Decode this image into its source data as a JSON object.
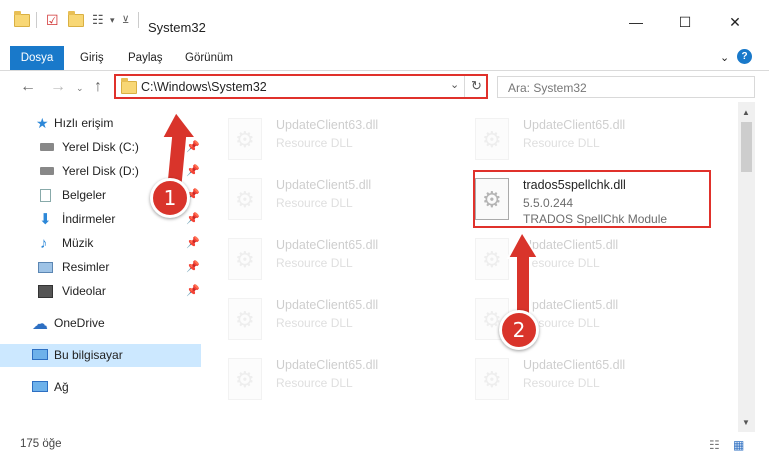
{
  "window": {
    "title": "System32",
    "minimize": "—",
    "maximize": "☐",
    "close": "✕"
  },
  "ribbon": {
    "tabs": [
      "Dosya",
      "Giriş",
      "Paylaş",
      "Görünüm"
    ]
  },
  "nav": {
    "back": "←",
    "forward": "→",
    "up": "↑",
    "address": "C:\\Windows\\System32",
    "search_placeholder": "Ara: System32"
  },
  "sidebar": {
    "items": [
      {
        "label": "Hızlı erişim",
        "icon": "star-icon"
      },
      {
        "label": "Yerel Disk (C:)",
        "icon": "drive-icon"
      },
      {
        "label": "Yerel Disk (D:)",
        "icon": "drive-icon"
      },
      {
        "label": "Belgeler",
        "icon": "documents-icon"
      },
      {
        "label": "İndirmeler",
        "icon": "download-icon"
      },
      {
        "label": "Müzik",
        "icon": "music-icon"
      },
      {
        "label": "Resimler",
        "icon": "pictures-icon"
      },
      {
        "label": "Videolar",
        "icon": "video-icon"
      },
      {
        "label": "OneDrive",
        "icon": "cloud-icon"
      },
      {
        "label": "Bu bilgisayar",
        "icon": "computer-icon"
      },
      {
        "label": "Ağ",
        "icon": "network-icon"
      }
    ]
  },
  "files": {
    "left": [
      {
        "name": "UpdateClient63.dll",
        "desc": "Resource DLL"
      },
      {
        "name": "UpdateClient5.dll",
        "desc": "Resource DLL"
      },
      {
        "name": "UpdateClient65.dll",
        "desc": "Resource DLL"
      },
      {
        "name": "UpdateClient65.dll",
        "desc": "Resource DLL"
      },
      {
        "name": "UpdateClient65.dll",
        "desc": "Resource DLL"
      }
    ],
    "right": [
      {
        "name": "UpdateClient65.dll",
        "desc": "Resource DLL"
      },
      {
        "name": "UpdateClient5.dll",
        "desc": "Resource DLL"
      },
      {
        "name": "UpdateClient5.dll",
        "desc": "Resource DLL"
      },
      {
        "name": "UpdateClient65.dll",
        "desc": "Resource DLL"
      }
    ],
    "highlighted": {
      "name": "trados5spellchk.dll",
      "version": "5.5.0.244",
      "desc": "TRADOS SpellChk Module"
    }
  },
  "status": {
    "count": "175 öğe"
  },
  "annotations": {
    "one": "1",
    "two": "2",
    "color": "#d9342b"
  }
}
